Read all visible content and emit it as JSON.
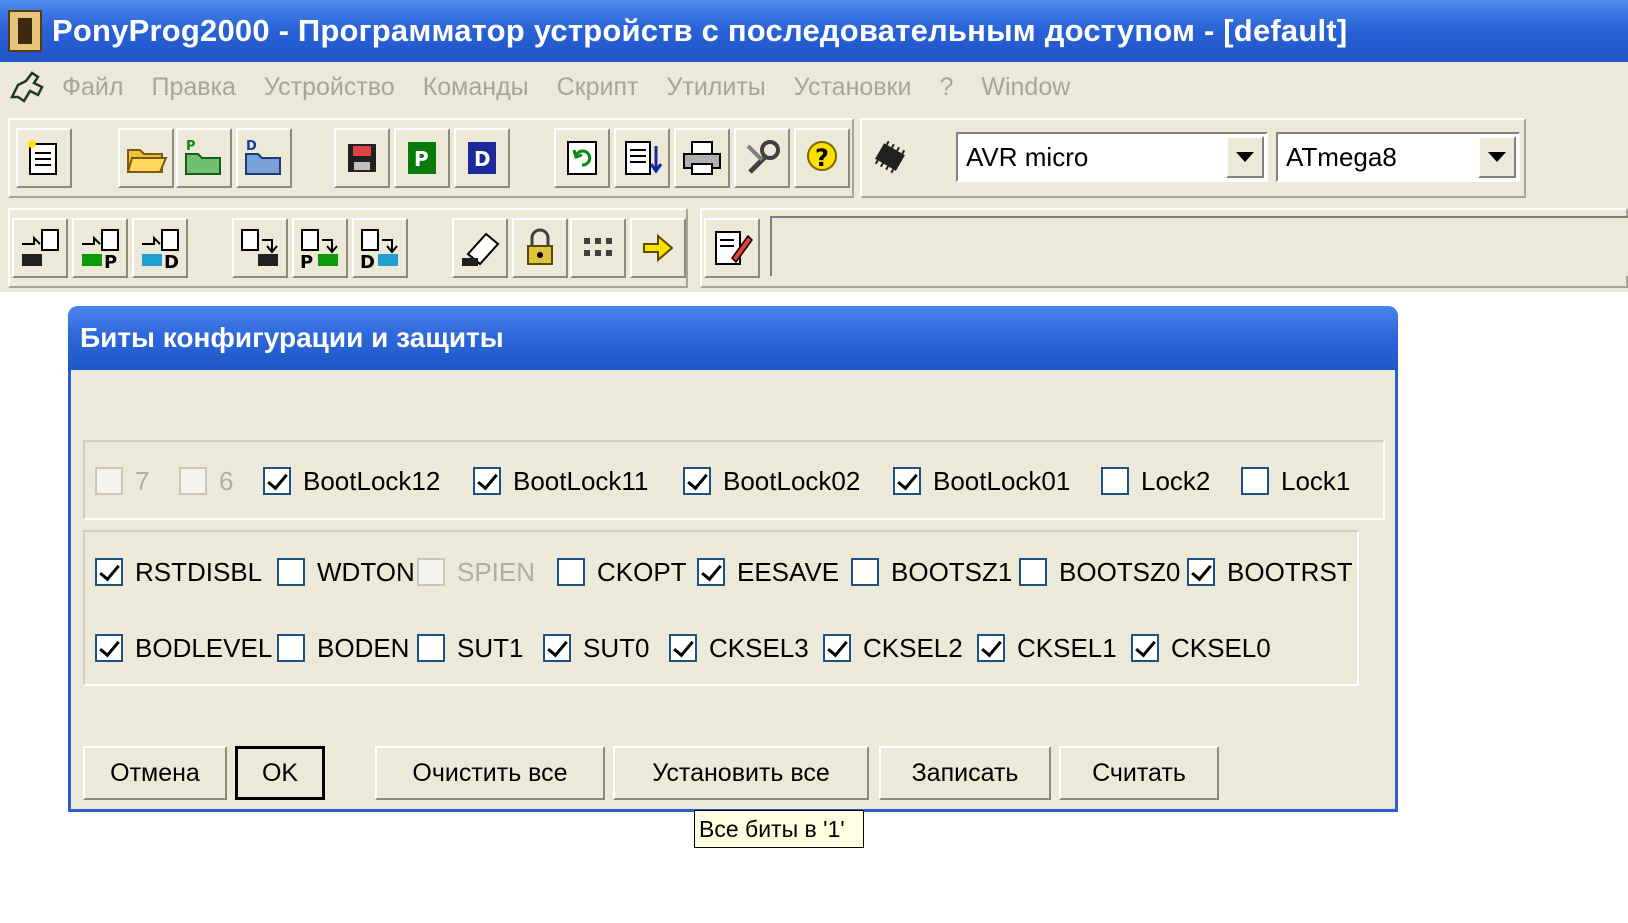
{
  "window": {
    "title": "PonyProg2000 - Программатор устройств с последовательным доступом - [default]"
  },
  "menu": {
    "items": [
      "Файл",
      "Правка",
      "Устройство",
      "Команды",
      "Скрипт",
      "Утилиты",
      "Установки",
      "?",
      "Window"
    ]
  },
  "toolbar": {
    "family_select": "AVR micro",
    "device_select": "ATmega8",
    "row1_icons": [
      "new-file-icon",
      "open-file-icon",
      "open-program-file-icon",
      "open-data-file-icon",
      "save-icon",
      "save-program-icon",
      "save-data-icon",
      "reload-icon",
      "edit-buffer-icon",
      "print-icon",
      "setup-icon",
      "help-icon",
      "device-chip-icon"
    ],
    "row2_icons": [
      "read-all-icon",
      "read-program-icon",
      "read-data-icon",
      "write-all-icon",
      "write-program-icon",
      "write-data-icon",
      "erase-icon",
      "security-bits-icon",
      "serial-number-icon",
      "program-icon",
      "script-edit-icon"
    ]
  },
  "dialog": {
    "title": "Биты конфигурации и защиты",
    "lock_bits": [
      {
        "label": "7",
        "checked": false,
        "enabled": false
      },
      {
        "label": "6",
        "checked": false,
        "enabled": false
      },
      {
        "label": "BootLock12",
        "checked": true,
        "enabled": true
      },
      {
        "label": "BootLock11",
        "checked": true,
        "enabled": true
      },
      {
        "label": "BootLock02",
        "checked": true,
        "enabled": true
      },
      {
        "label": "BootLock01",
        "checked": true,
        "enabled": true
      },
      {
        "label": "Lock2",
        "checked": false,
        "enabled": true
      },
      {
        "label": "Lock1",
        "checked": false,
        "enabled": true
      }
    ],
    "fuse_high": [
      {
        "label": "RSTDISBL",
        "checked": true,
        "enabled": true
      },
      {
        "label": "WDTON",
        "checked": false,
        "enabled": true
      },
      {
        "label": "SPIEN",
        "checked": false,
        "enabled": false
      },
      {
        "label": "CKOPT",
        "checked": false,
        "enabled": true
      },
      {
        "label": "EESAVE",
        "checked": true,
        "enabled": true
      },
      {
        "label": "BOOTSZ1",
        "checked": false,
        "enabled": true
      },
      {
        "label": "BOOTSZ0",
        "checked": false,
        "enabled": true
      },
      {
        "label": "BOOTRST",
        "checked": true,
        "enabled": true
      }
    ],
    "fuse_low": [
      {
        "label": "BODLEVEL",
        "checked": true,
        "enabled": true
      },
      {
        "label": "BODEN",
        "checked": false,
        "enabled": true
      },
      {
        "label": "SUT1",
        "checked": false,
        "enabled": true
      },
      {
        "label": "SUT0",
        "checked": true,
        "enabled": true
      },
      {
        "label": "CKSEL3",
        "checked": true,
        "enabled": true
      },
      {
        "label": "CKSEL2",
        "checked": true,
        "enabled": true
      },
      {
        "label": "CKSEL1",
        "checked": true,
        "enabled": true
      },
      {
        "label": "CKSEL0",
        "checked": true,
        "enabled": true
      }
    ],
    "buttons": {
      "cancel": "Отмена",
      "ok": "OK",
      "clear_all": "Очистить все",
      "set_all": "Установить все",
      "write": "Записать",
      "read": "Считать"
    }
  },
  "tooltip": "Все биты в '1'",
  "colors": {
    "title_blue": "#2a63d6",
    "face": "#ece9d8",
    "tooltip_bg": "#ffffe1"
  }
}
